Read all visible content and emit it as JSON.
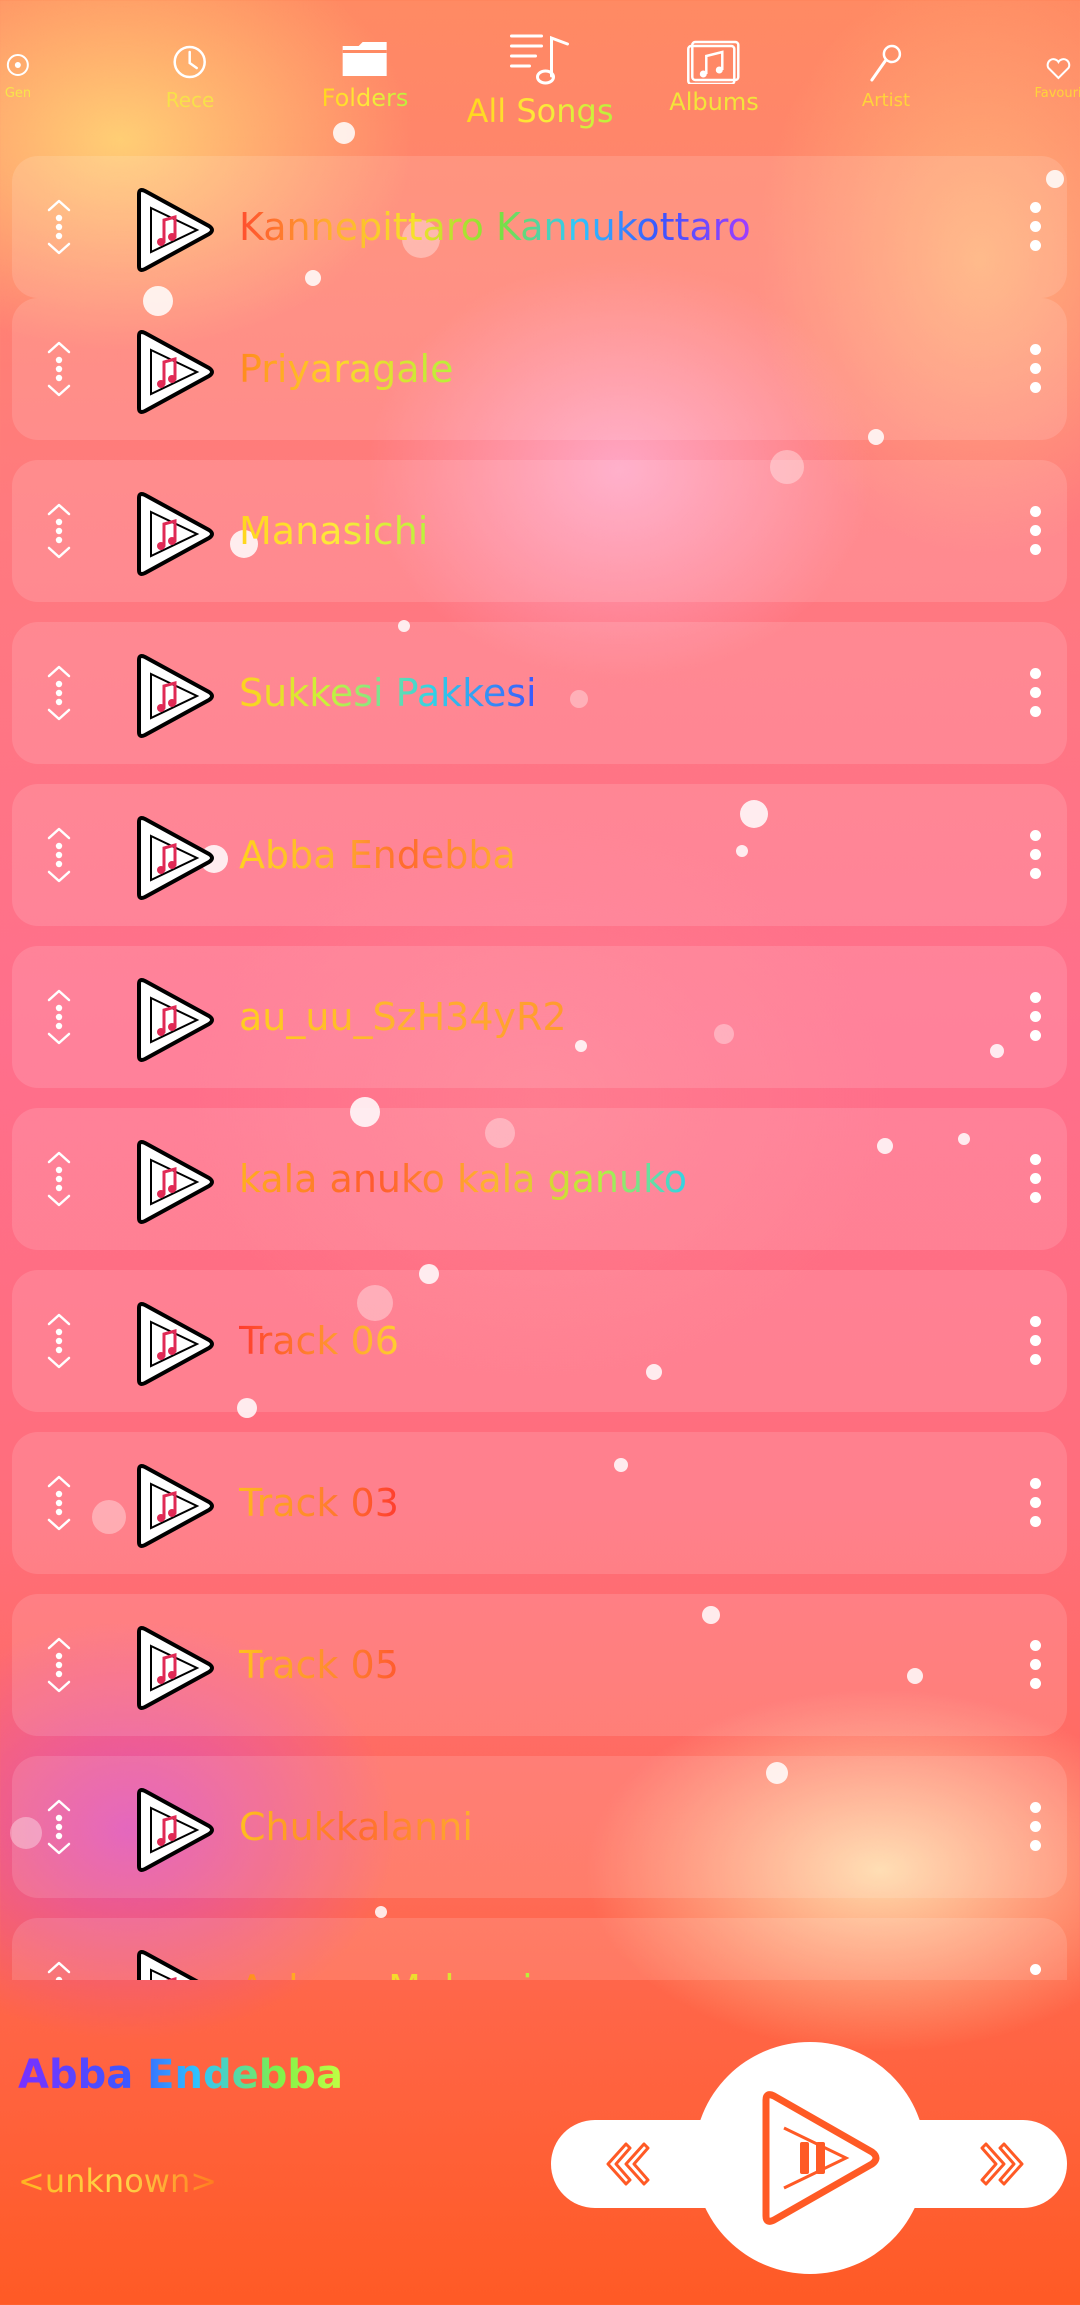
{
  "tabs": [
    {
      "label": "Gen",
      "icon": "genre-icon"
    },
    {
      "label": "Rece",
      "icon": "recent-clock-icon"
    },
    {
      "label": "Folders",
      "icon": "folder-icon"
    },
    {
      "label": "All Songs",
      "icon": "music-list-icon"
    },
    {
      "label": "Albums",
      "icon": "album-icon"
    },
    {
      "label": "Artist",
      "icon": "microphone-icon"
    },
    {
      "label": "Favouri",
      "icon": "heart-icon"
    }
  ],
  "songs": [
    {
      "title": "Kannepittaro Kannukottaro"
    },
    {
      "title": "Priyaragale"
    },
    {
      "title": "Manasichi"
    },
    {
      "title": "Sukkesi Pakkesi"
    },
    {
      "title": "Abba Endebba"
    },
    {
      "title": "au_uu_SzH34yR2"
    },
    {
      "title": "kala anuko kala ganuko"
    },
    {
      "title": "Track 06"
    },
    {
      "title": "Track 03"
    },
    {
      "title": "Track 05"
    },
    {
      "title": "Chukkalanni"
    },
    {
      "title": "Aakasa Maloaci"
    }
  ],
  "now_playing": {
    "title": "Abba Endebba",
    "artist": "<unknown>"
  },
  "colors": {
    "accent": "#ff5a25",
    "background_top": "#ff8a63",
    "background_bottom": "#ff5a25",
    "icon_white": "#ffffff"
  }
}
